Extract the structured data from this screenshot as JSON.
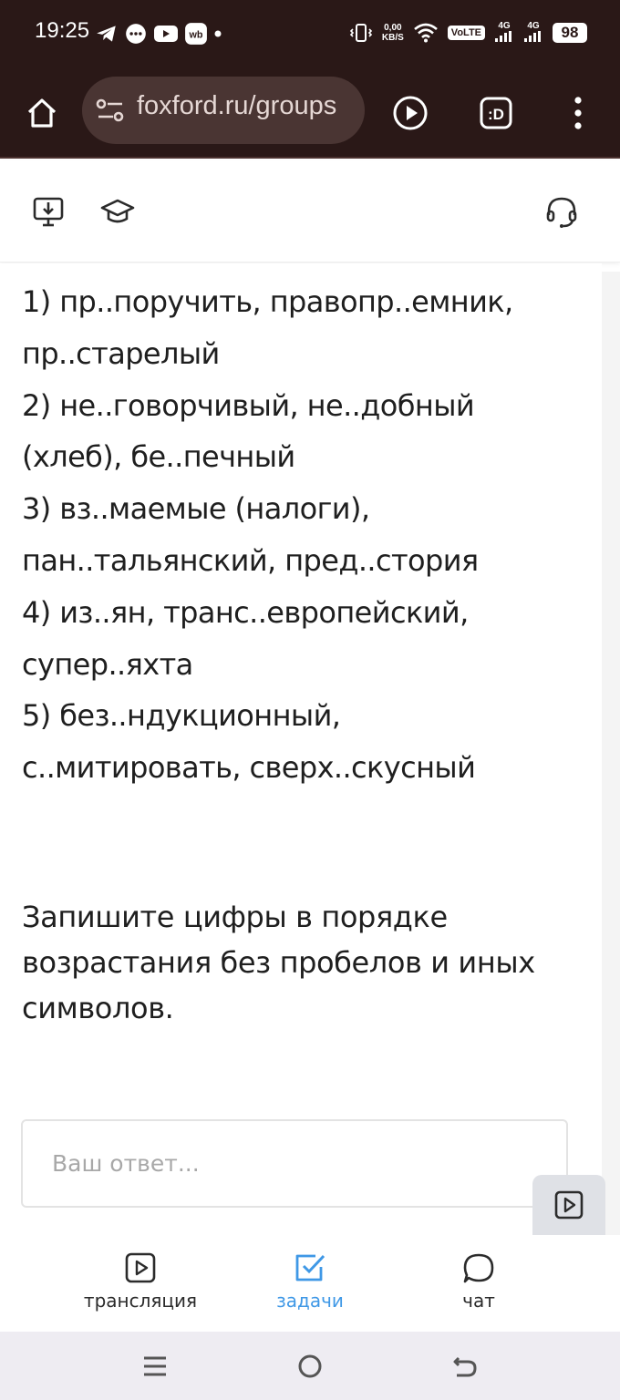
{
  "status_bar": {
    "time": "19:25",
    "speed_value": "0,00",
    "speed_unit": "KB/S",
    "volte": "VoLTE",
    "net1": "4G",
    "net2": "4G",
    "battery": "98"
  },
  "browser": {
    "url": "foxford.ru/groups"
  },
  "content": {
    "lines": [
      "1) пр..поручить, правопр..емник,",
      "пр..старелый",
      "2) не..говорчивый, не..добный",
      "(хлеб), бе..печный",
      "3) вз..маемые (налоги),",
      "пан..тальянский, пред..стория",
      "4) из..ян, транс..европейский,",
      "супер..яхта",
      "5) без..ндукционный,",
      "с..митировать, сверх..скусный"
    ],
    "instruction": "Запишите цифры в порядке возрастания без пробелов и иных символов.",
    "answer_placeholder": "Ваш ответ...",
    "answer_value": ""
  },
  "bottom_nav": {
    "items": [
      {
        "label": "трансляция",
        "icon": "play-square-icon",
        "active": false
      },
      {
        "label": "задачи",
        "icon": "checkbox-icon",
        "active": true
      },
      {
        "label": "чат",
        "icon": "chat-bubble-icon",
        "active": false
      }
    ]
  },
  "colors": {
    "browser_bg": "#2a1817",
    "url_bar_bg": "#4a3533",
    "accent": "#3f98e6",
    "text": "#1f1f1f",
    "placeholder": "#a8a8a8"
  }
}
